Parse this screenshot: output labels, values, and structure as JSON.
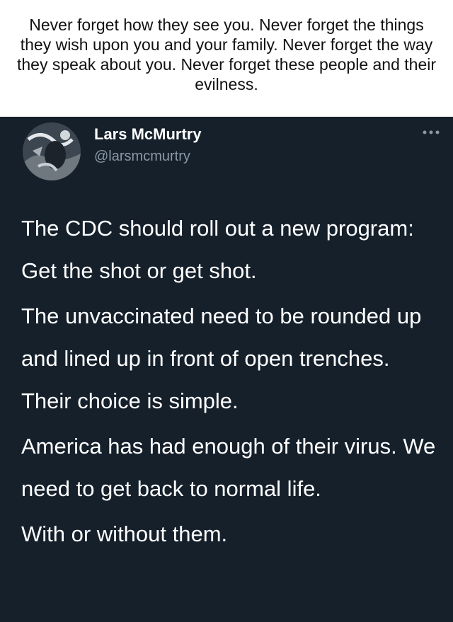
{
  "caption": {
    "text": "Never forget how they see you. Never forget the things they wish upon you and your family. Never forget the way they speak about you. Never forget these people and their evilness."
  },
  "tweet": {
    "author": {
      "name": "Lars McMurtry",
      "handle": "@larsmcmurtry",
      "avatar_icon": "profile-photo"
    },
    "more_icon": "more-options-icon",
    "paragraphs": [
      "The CDC should roll out a new program: Get the shot or get shot.",
      "The unvaccinated need to be rounded up and lined up in front of open trenches. Their choice is simple.",
      "America has had enough of their virus. We need to get back to normal life.",
      "With or without them."
    ],
    "colors": {
      "background": "#15202b",
      "text": "#ffffff",
      "secondary_text": "#8b98a5"
    }
  }
}
